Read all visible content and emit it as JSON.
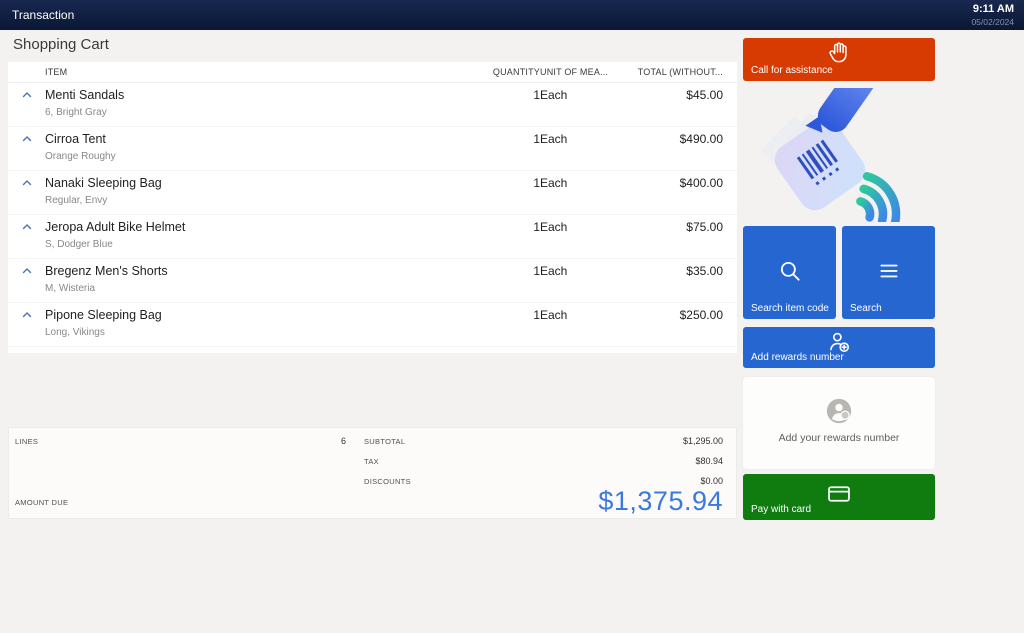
{
  "topbar": {
    "title": "Transaction",
    "time": "9:11 AM",
    "date": "05/02/2024"
  },
  "page_title": "Shopping Cart",
  "cart": {
    "columns": {
      "item": "ITEM",
      "quantity": "QUANTITY",
      "unit": "UNIT OF MEA...",
      "total": "TOTAL (WITHOUT..."
    },
    "items": [
      {
        "name": "Menti Sandals",
        "variant": "6, Bright Gray",
        "quantity": "1",
        "unit": "Each",
        "total": "$45.00"
      },
      {
        "name": "Cirroa Tent",
        "variant": "Orange Roughy",
        "quantity": "1",
        "unit": "Each",
        "total": "$490.00"
      },
      {
        "name": "Nanaki Sleeping Bag",
        "variant": "Regular, Envy",
        "quantity": "1",
        "unit": "Each",
        "total": "$400.00"
      },
      {
        "name": "Jeropa Adult Bike Helmet",
        "variant": "S, Dodger Blue",
        "quantity": "1",
        "unit": "Each",
        "total": "$75.00"
      },
      {
        "name": "Bregenz Men's Shorts",
        "variant": "M, Wisteria",
        "quantity": "1",
        "unit": "Each",
        "total": "$35.00"
      },
      {
        "name": "Pipone Sleeping Bag",
        "variant": "Long, Vikings",
        "quantity": "1",
        "unit": "Each",
        "total": "$250.00"
      }
    ]
  },
  "summary": {
    "lines_label": "LINES",
    "lines_value": "6",
    "subtotal_label": "SUBTOTAL",
    "subtotal_value": "$1,295.00",
    "tax_label": "TAX",
    "tax_value": "$80.94",
    "discounts_label": "DISCOUNTS",
    "discounts_value": "$0.00",
    "amount_due_label": "AMOUNT DUE",
    "amount_due_value": "$1,375.94"
  },
  "sidebar": {
    "call_assistance": "Call for assistance",
    "search_item_code": "Search item code",
    "search": "Search",
    "add_rewards": "Add rewards number",
    "rewards_hint": "Add your rewards number",
    "pay_with_card": "Pay with card"
  },
  "colors": {
    "topbar-bg": "#0a1834",
    "accent-orange": "#d83b01",
    "accent-blue": "#2566d0",
    "accent-green": "#107c10",
    "amount-due": "#3b79dd"
  }
}
